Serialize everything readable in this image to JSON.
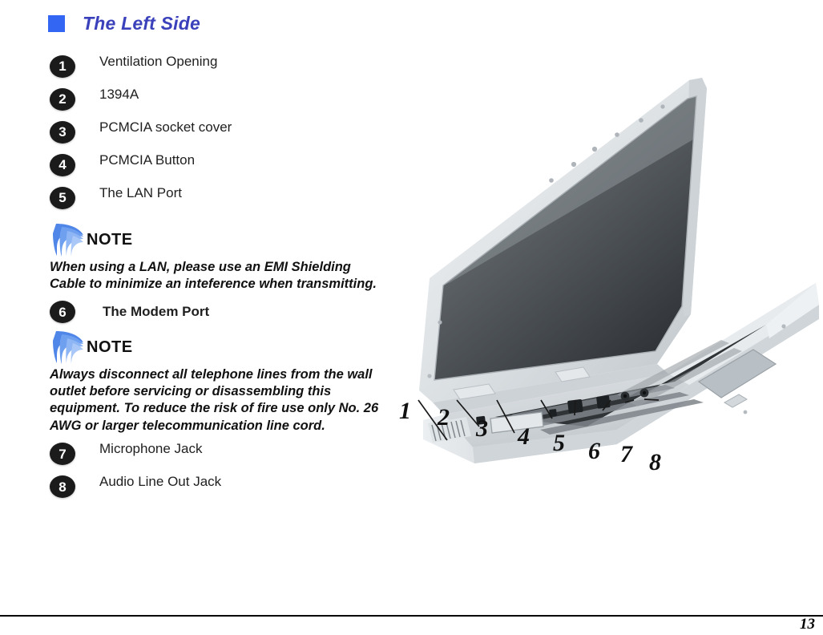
{
  "heading": {
    "bullet_color": "#3366f2",
    "text_color": "#3a41bb",
    "title": "The Left Side"
  },
  "callouts": [
    {
      "number": "1",
      "label": "Ventilation Opening"
    },
    {
      "number": "2",
      "label": "1394A"
    },
    {
      "number": "3",
      "label": "PCMCIA socket cover"
    },
    {
      "number": "4",
      "label": "PCMCIA Button"
    },
    {
      "number": "5",
      "label": "The LAN Port"
    },
    {
      "number": "6",
      "label": "The Modem Port"
    },
    {
      "number": "7",
      "label": "Microphone Jack"
    },
    {
      "number": "8",
      "label": "Audio Line Out Jack"
    }
  ],
  "notes": [
    {
      "icon": "note-swoosh-icon",
      "title": "NOTE",
      "body": "When using a LAN, please use an EMI Shielding Cable to minimize an inteference when transmitting."
    },
    {
      "icon": "note-swoosh-icon",
      "title": "NOTE",
      "body": "Always disconnect all telephone lines from the wall outlet before servicing or disassembling this equipment. To reduce the risk of fire use only No. 26 AWG or larger telecommunication line cord."
    }
  ],
  "figure": {
    "alt": "Open silver notebook computer viewed from the front left showing the left-side ports",
    "callout_markers": [
      "1",
      "2",
      "3",
      "4",
      "5",
      "6",
      "7",
      "8"
    ],
    "colors": {
      "screen_dark": "#3c4146",
      "screen_light": "#9aa0a4",
      "chassis_light": "#e9ecee",
      "chassis_mid": "#c9ced2",
      "chassis_shadow": "#a8aeb3",
      "keys": "#2b2e31"
    }
  },
  "footer": {
    "page_number": "13"
  }
}
